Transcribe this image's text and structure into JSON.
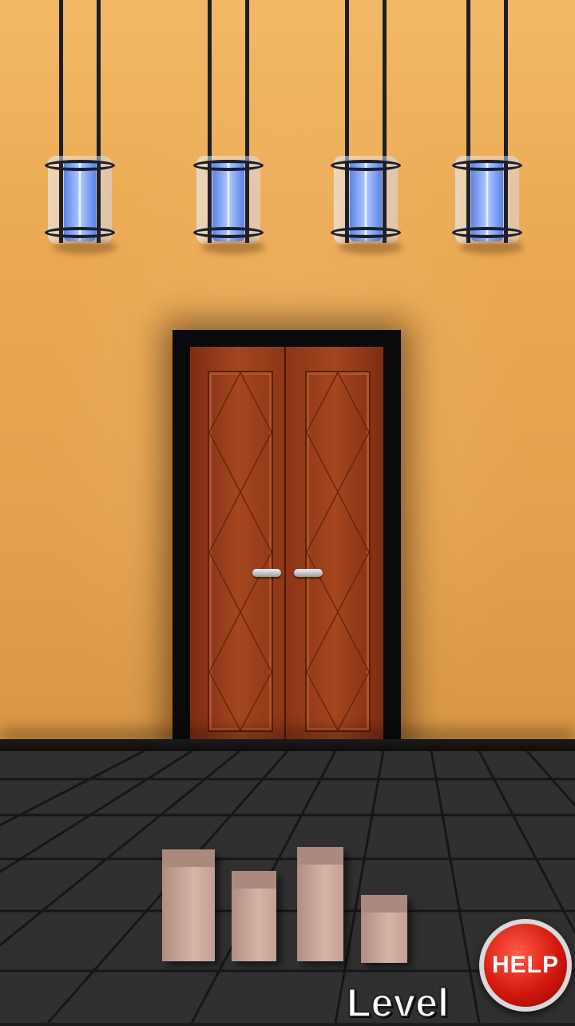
{
  "help_button": {
    "label": "HELP"
  },
  "level_label": "Level",
  "colors": {
    "wall": "#eaa853",
    "door": "#a4461f",
    "floor": "#303030",
    "help": "#d3190d"
  },
  "icons": {
    "lantern": "lantern-icon"
  }
}
